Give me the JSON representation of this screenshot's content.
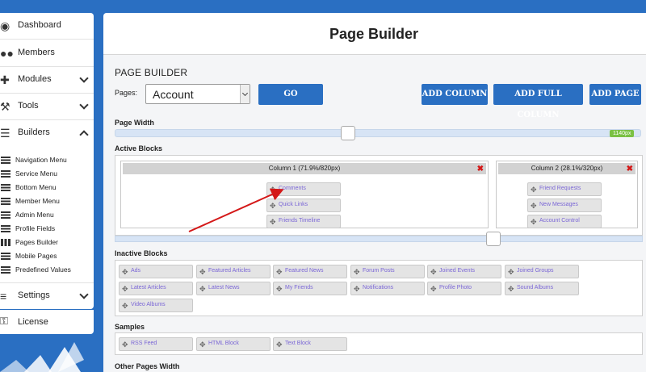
{
  "sidebar": {
    "items": [
      {
        "label": "Dashboard",
        "icon": "palette-icon"
      },
      {
        "label": "Members",
        "icon": "users-icon"
      },
      {
        "label": "Modules",
        "icon": "puzzle-icon"
      },
      {
        "label": "Tools",
        "icon": "wrench-icon"
      },
      {
        "label": "Builders",
        "icon": "bars-icon"
      }
    ],
    "sub_items": [
      "Navigation Menu",
      "Service Menu",
      "Bottom Menu",
      "Member Menu",
      "Admin Menu",
      "Profile Fields",
      "Pages Builder",
      "Mobile Pages",
      "Predefined Values"
    ],
    "settings_label": "Settings",
    "license_label": "License"
  },
  "main": {
    "title": "Page Builder",
    "heading": "PAGE BUILDER",
    "pages_label": "Pages:",
    "pages_selected": "Account",
    "go_label": "GO",
    "add_column_label": "ADD COLUMN",
    "add_full_column_label": "ADD FULL COLUMN",
    "add_page_label": "ADD PAGE",
    "page_width_label": "Page Width",
    "page_width_value": "1140px",
    "active_blocks_label": "Active Blocks",
    "columns": [
      {
        "title": "Column 1 (71.9%/820px)",
        "blocks": [
          "Comments",
          "Quick Links",
          "Friends Timeline"
        ]
      },
      {
        "title": "Column 2 (28.1%/320px)",
        "blocks": [
          "Friend Requests",
          "New Messages",
          "Account Control"
        ]
      }
    ],
    "inactive_blocks_label": "Inactive Blocks",
    "inactive_blocks": [
      "Ads",
      "Featured Articles",
      "Featured News",
      "Forum Posts",
      "Joined Events",
      "Joined Groups",
      "Latest Articles",
      "Latest News",
      "My Friends",
      "Notifications",
      "Profile Photo",
      "Sound Albums",
      "Video Albums"
    ],
    "samples_label": "Samples",
    "samples": [
      "RSS Feed",
      "HTML Block",
      "Text Block"
    ],
    "other_pages_label": "Other Pages Width"
  },
  "colors": {
    "accent": "#2a6fc2",
    "badge": "#7ac143",
    "remove": "#d41818",
    "block_text": "#7a66d6"
  }
}
